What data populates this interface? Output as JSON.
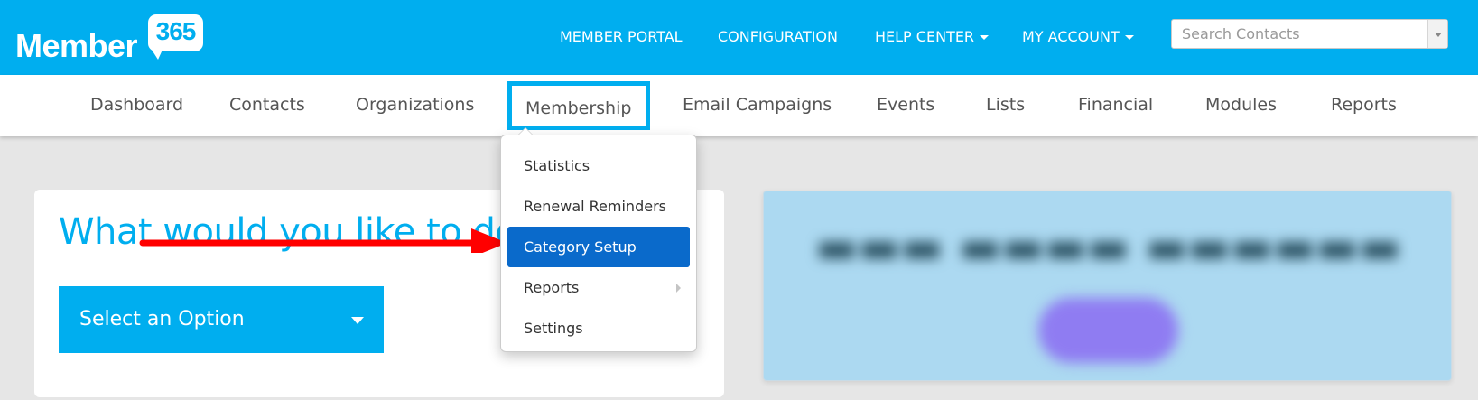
{
  "brand": {
    "logo_word": "Member",
    "logo_number": "365"
  },
  "top_nav": {
    "member_portal": "MEMBER PORTAL",
    "configuration": "CONFIGURATION",
    "help_center": "HELP CENTER",
    "my_account": "MY ACCOUNT"
  },
  "search": {
    "placeholder": "Search Contacts",
    "value": ""
  },
  "main_nav": {
    "items": [
      {
        "label": "Dashboard"
      },
      {
        "label": "Contacts"
      },
      {
        "label": "Organizations"
      },
      {
        "label": "Membership"
      },
      {
        "label": "Email Campaigns"
      },
      {
        "label": "Events"
      },
      {
        "label": "Lists"
      },
      {
        "label": "Financial"
      },
      {
        "label": "Modules"
      },
      {
        "label": "Reports"
      }
    ],
    "highlighted": "Membership"
  },
  "membership_menu": {
    "items": [
      {
        "label": "Statistics"
      },
      {
        "label": "Renewal Reminders"
      },
      {
        "label": "Category Setup"
      },
      {
        "label": "Reports"
      },
      {
        "label": "Settings"
      }
    ],
    "active": "Category Setup"
  },
  "left_card": {
    "heading": "What would you like to do?",
    "select_label": "Select an Option"
  },
  "colors": {
    "brand_blue": "#00aeef",
    "menu_active": "#0a6acb",
    "annotation_arrow": "#ff0000",
    "promo_background": "#acd9f1"
  }
}
